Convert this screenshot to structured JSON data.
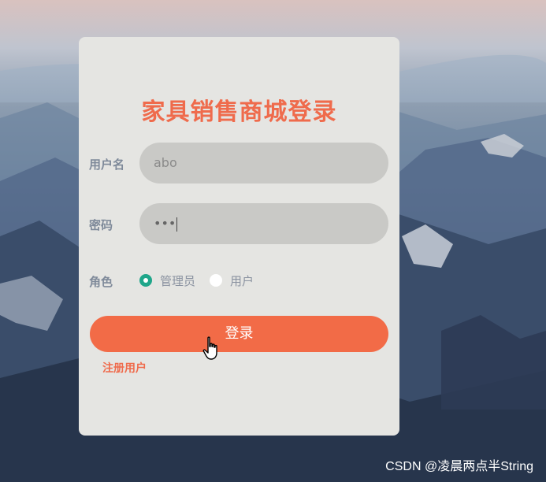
{
  "form": {
    "title": "家具销售商城登录",
    "username_label": "用户名",
    "username_value": "abo",
    "password_label": "密码",
    "password_value": "•••",
    "role_label": "角色",
    "roles": [
      {
        "label": "管理员",
        "selected": true
      },
      {
        "label": "用户",
        "selected": false
      }
    ],
    "login_label": "登录",
    "register_link": "注册用户"
  },
  "watermark": "CSDN @凌晨两点半String",
  "colors": {
    "accent": "#f26b47",
    "title": "#ef6b4c",
    "radio_selected": "#1fa68a",
    "panel": "#e5e5e2"
  },
  "icons": [
    "radio-selected-icon",
    "radio-unselected-icon",
    "hand-pointer-cursor-icon"
  ]
}
